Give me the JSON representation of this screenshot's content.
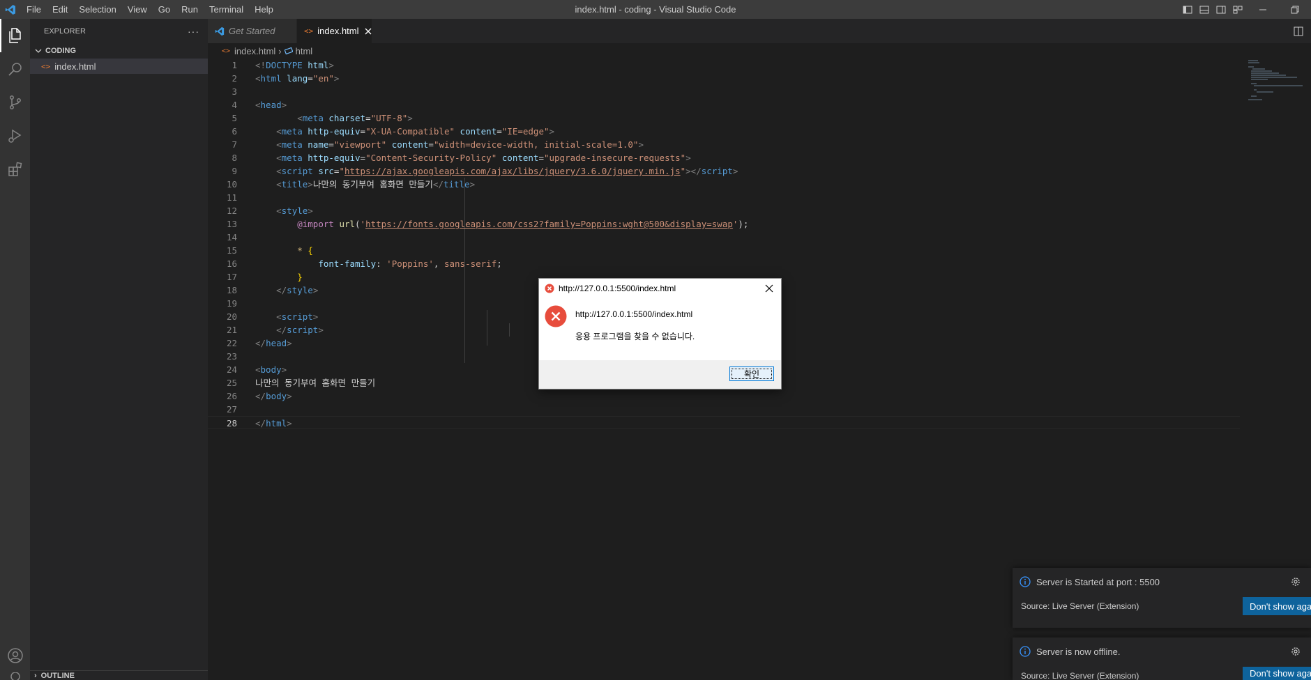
{
  "titlebar": {
    "menu": [
      "File",
      "Edit",
      "Selection",
      "View",
      "Go",
      "Run",
      "Terminal",
      "Help"
    ],
    "window_title": "index.html - coding - Visual Studio Code"
  },
  "sidebar": {
    "header": "EXPLORER",
    "section": "CODING",
    "file": "index.html",
    "outline": "OUTLINE"
  },
  "tabs": [
    {
      "label": "Get Started"
    },
    {
      "label": "index.html"
    }
  ],
  "breadcrumb": {
    "file": "index.html",
    "symbol": "html"
  },
  "editor": {
    "line_numbers": [
      "1",
      "2",
      "3",
      "4",
      "5",
      "6",
      "7",
      "8",
      "9",
      "10",
      "11",
      "12",
      "13",
      "14",
      "15",
      "16",
      "17",
      "18",
      "19",
      "20",
      "21",
      "22",
      "23",
      "24",
      "25",
      "26",
      "27",
      "28"
    ],
    "current_line": "28"
  },
  "dialog": {
    "title": "http://127.0.0.1:5500/index.html",
    "url": "http://127.0.0.1:5500/index.html",
    "message": "응용 프로그램을 찾을 수 없습니다.",
    "ok": "확인"
  },
  "notifications": [
    {
      "message": "Server is Started at port : 5500",
      "source": "Source: Live Server (Extension)",
      "button": "Don't show again"
    },
    {
      "message": "Server is now offline.",
      "source": "Source: Live Server (Extension)",
      "button": "Don't show again"
    }
  ],
  "colors": {
    "accent": "#0e639c",
    "editor_bg": "#1e1e1e",
    "error_red": "#e74c3c"
  }
}
